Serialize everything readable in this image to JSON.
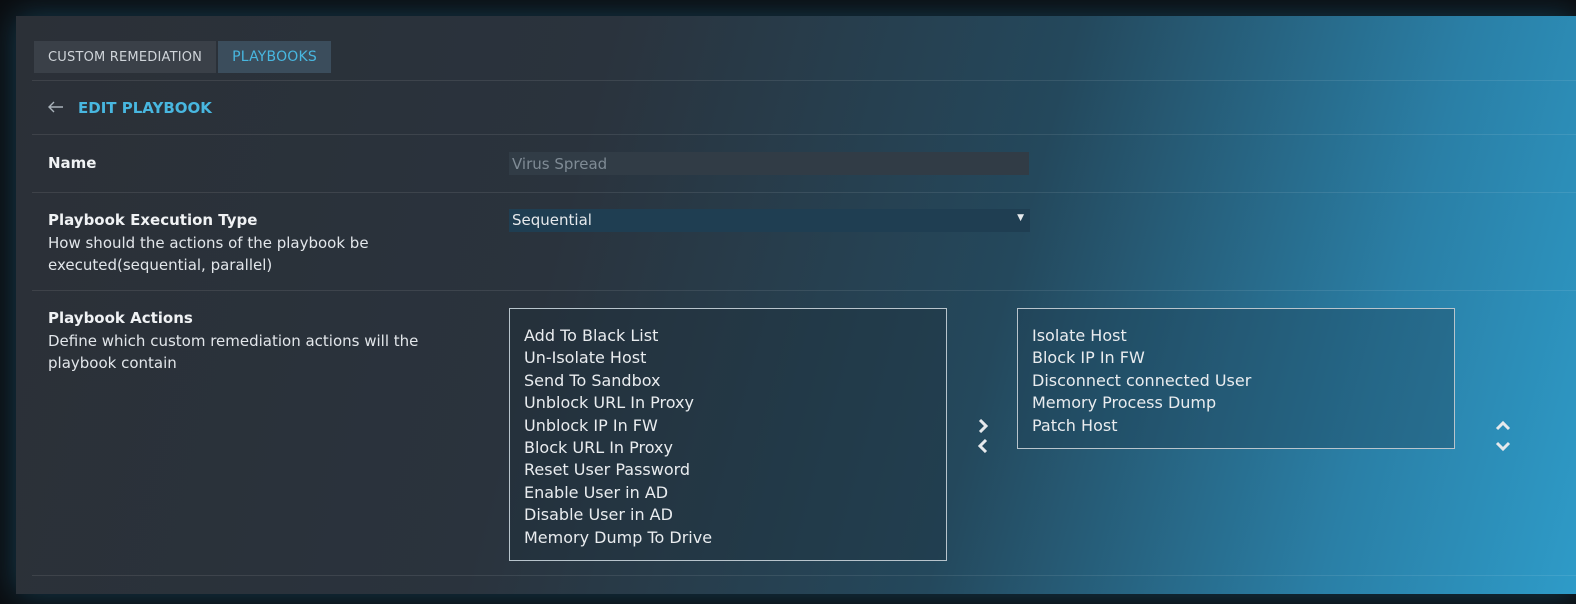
{
  "tabs": [
    {
      "label": "CUSTOM REMEDIATION"
    },
    {
      "label": "PLAYBOOKS"
    }
  ],
  "header": {
    "back_icon": "arrow-left-icon",
    "title": "EDIT PLAYBOOK"
  },
  "name_field": {
    "label": "Name",
    "value": "Virus Spread"
  },
  "execution_type": {
    "label": "Playbook Execution Type",
    "description": "How should the actions of the playbook be executed(sequential, parallel)",
    "selected": "Sequential"
  },
  "actions": {
    "label": "Playbook Actions",
    "description": "Define which custom remediation actions will the playbook contain",
    "available": [
      "Add To Black List",
      "Un-Isolate Host",
      "Send To Sandbox",
      "Unblock URL In Proxy",
      "Unblock IP In FW",
      "Block URL In Proxy",
      "Reset User Password",
      "Enable User in AD",
      "Disable User in AD",
      "Memory Dump To Drive"
    ],
    "selected": [
      "Isolate Host",
      "Block IP In FW",
      "Disconnect connected User",
      "Memory Process Dump",
      "Patch Host"
    ]
  },
  "colors": {
    "accent": "#48b7e0"
  }
}
